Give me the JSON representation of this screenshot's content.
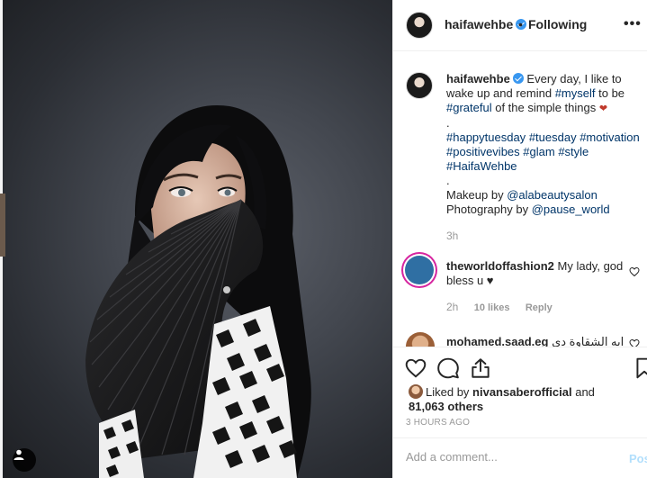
{
  "post": {
    "username": "haifawehbe",
    "follow_dot": "•",
    "follow_status": "Following",
    "more_label": "•••"
  },
  "caption": {
    "username": "haifawehbe",
    "text_1": "Every day, I like to",
    "text_2": "wake up and remind",
    "tag_myself": "#myself",
    "text_3": "to be",
    "tag_grateful": "#grateful",
    "text_4": "of the simple things",
    "emoji": "❤",
    "dot_1": ".",
    "tags_line_1": [
      "#happytuesday",
      "#tuesday",
      "#motivation"
    ],
    "tags_line_2": [
      "#positivevibes",
      "#glam",
      "#style"
    ],
    "tags_line_3": [
      "#HaifaWehbe"
    ],
    "dot_2": ".",
    "makeup_label": "Makeup by",
    "makeup_mention": "@alabeautysalon",
    "photo_label": "Photography by",
    "photo_mention": "@pause_world",
    "time": "3h"
  },
  "comments": [
    {
      "username": "theworldoffashion2",
      "text": "My lady, god bless u ♥",
      "time": "2h",
      "likes": "10 likes",
      "reply": "Reply"
    },
    {
      "username": "mohamed.saad.eg",
      "text": "ايه الشقاوة دي"
    }
  ],
  "likes": {
    "prefix": "Liked by",
    "user": "nivansaberofficial",
    "and": "and",
    "count": "81,063 others"
  },
  "timestamp": "3 HOURS AGO",
  "composer": {
    "placeholder": "Add a comment...",
    "post_label": "Post"
  },
  "colors": {
    "hashtag": "#003569",
    "verified": "#3897f0",
    "muted": "#999999",
    "post_disabled": "#b2dffc"
  }
}
